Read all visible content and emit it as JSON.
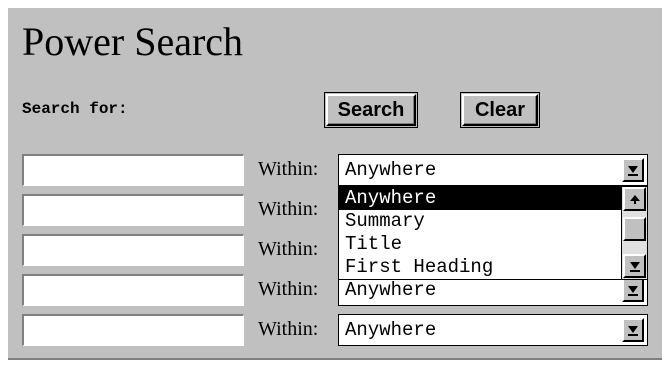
{
  "title": "Power Search",
  "search_for_label": "Search for:",
  "buttons": {
    "search": "Search",
    "clear": "Clear"
  },
  "within_label": "Within:",
  "rows": [
    {
      "value": "",
      "scope": "Anywhere"
    },
    {
      "value": "",
      "scope": "Anywhere"
    },
    {
      "value": "",
      "scope": "Anywhere"
    },
    {
      "value": "",
      "scope": "Anywhere"
    },
    {
      "value": "",
      "scope": "Anywhere"
    }
  ],
  "dropdown": {
    "options": [
      "Anywhere",
      "Summary",
      "Title",
      "First Heading"
    ],
    "selected_index": 0
  },
  "icons": {
    "select_arrow": "arrow-down-bar-icon",
    "scroll_up": "arrow-up-icon",
    "scroll_down": "arrow-down-bar-icon"
  }
}
